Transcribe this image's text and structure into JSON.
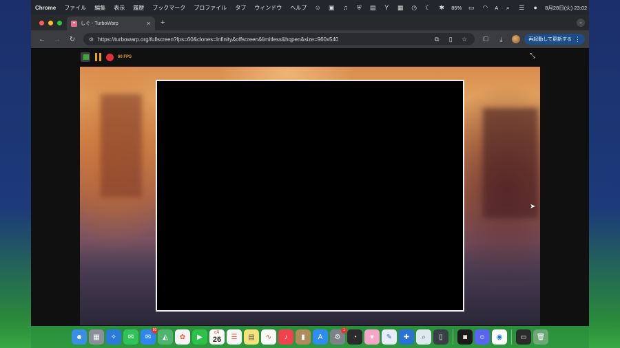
{
  "menubar": {
    "app_name": "Chrome",
    "menus": [
      "ファイル",
      "編集",
      "表示",
      "履歴",
      "ブックマーク",
      "プロファイル",
      "タブ",
      "ウィンドウ",
      "ヘルプ"
    ],
    "battery": "85%",
    "input_mode": "A",
    "datetime": "8月28日(火)  23:02"
  },
  "browser": {
    "tab_title": "しぐ - TurboWarp",
    "url": "https://turbowarp.org/fullscreen?fps=60&clones=Infinity&offscreen&limitless&hqpen&size=960x540",
    "relaunch_label": "再起動して更新する"
  },
  "player": {
    "fps_label": "60 FPS"
  },
  "dock": {
    "calendar_month": "8月",
    "calendar_day": "26",
    "mail_badge": "50",
    "settings_badge": "1"
  },
  "colors": {
    "menubar_bg": "#23262c",
    "tab_active_bg": "#3b3c3f",
    "relaunch_bg": "#1d4d86",
    "flag_green": "#3fa33a",
    "pause_orange": "#e5a229",
    "stop_red": "#e0303a"
  }
}
